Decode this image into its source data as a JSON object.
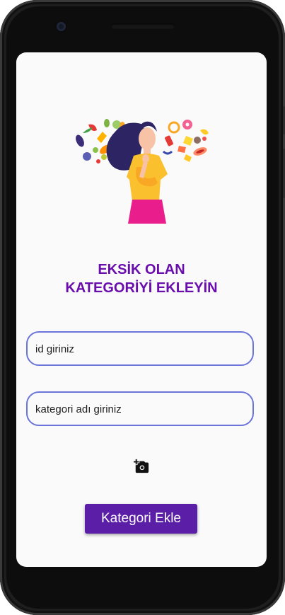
{
  "heading": {
    "line1": "EKSİK OLAN",
    "line2": "KATEGORİYİ EKLEYİN"
  },
  "form": {
    "id_placeholder": "id giriniz",
    "name_placeholder": "kategori adı giriniz"
  },
  "actions": {
    "add_photo_icon": "add-a-photo-icon",
    "submit_label": "Kategori Ekle"
  },
  "colors": {
    "heading": "#6a0dad",
    "field_border": "#6b74d8",
    "button": "#5b1ea6"
  }
}
